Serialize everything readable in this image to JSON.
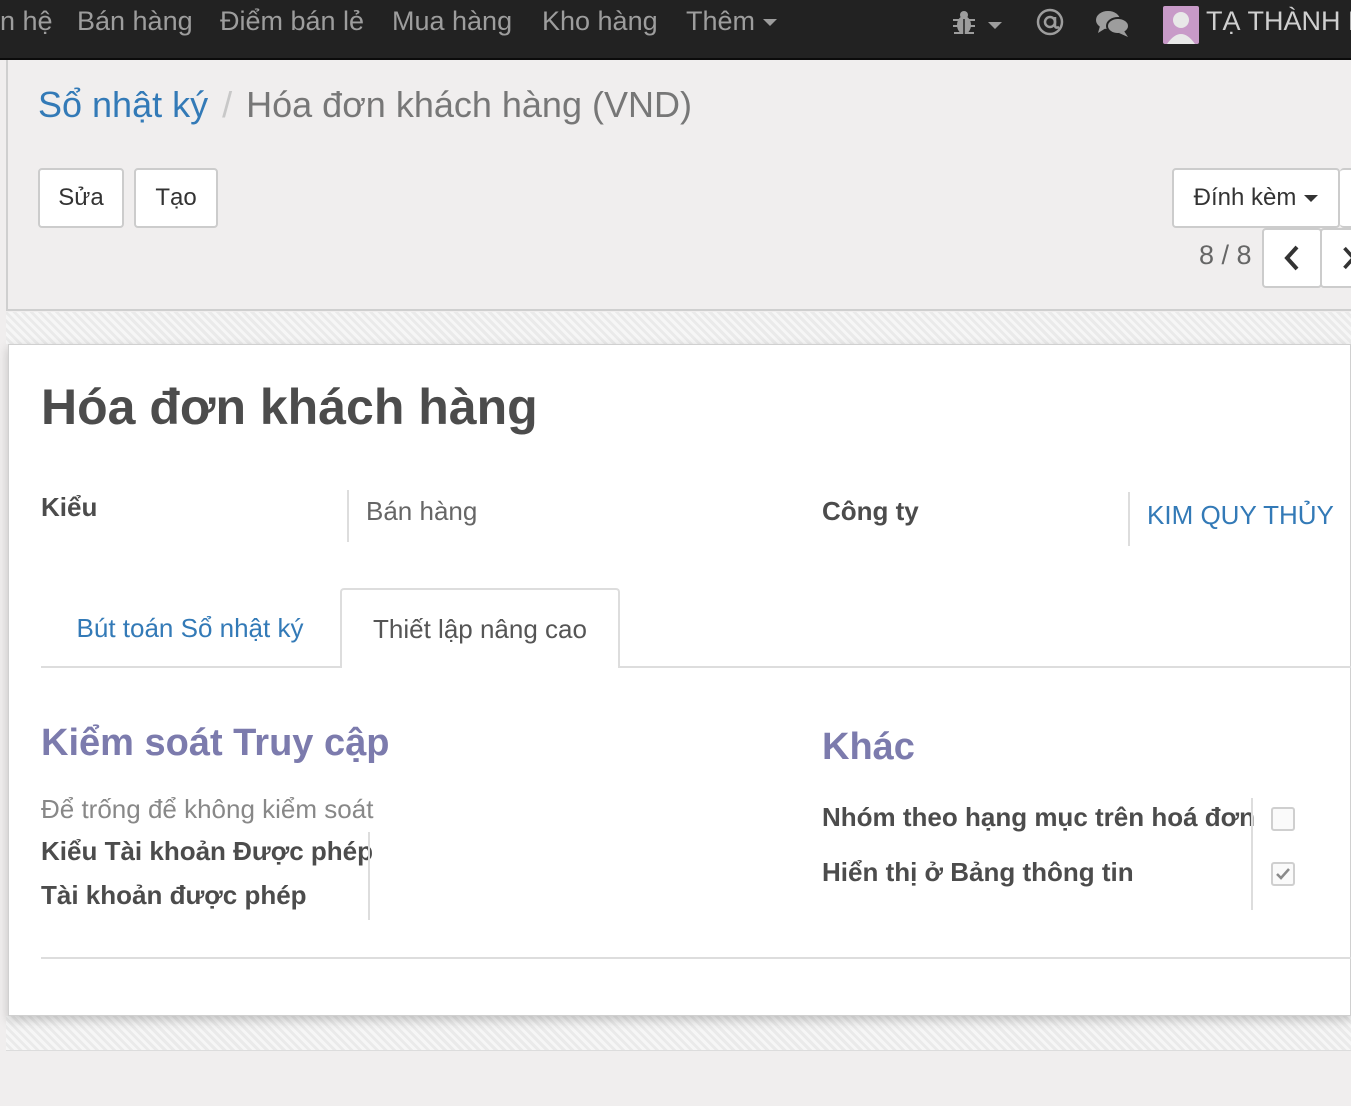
{
  "nav": {
    "menu": [
      "n hệ",
      "Bán hàng",
      "Điểm bán lẻ",
      "Mua hàng",
      "Kho hàng"
    ],
    "more_label": "Thêm",
    "user_name": "TẠ THÀNH N",
    "icons": [
      "bug-icon",
      "at-icon",
      "chat-icon"
    ]
  },
  "breadcrumb": {
    "parent": "Sổ nhật ký",
    "separator": "/",
    "current": "Hóa đơn khách hàng (VND)"
  },
  "buttons": {
    "edit": "Sửa",
    "create": "Tạo",
    "attach": "Đính kèm"
  },
  "pager": {
    "value": "8 / 8"
  },
  "record": {
    "title": "Hóa đơn khách hàng",
    "type_label": "Kiểu",
    "type_value": "Bán hàng",
    "company_label": "Công ty",
    "company_value": "KIM QUY THỦY"
  },
  "tabs": [
    {
      "label": "Bút toán Sổ nhật ký",
      "active": false
    },
    {
      "label": "Thiết lập nâng cao",
      "active": true
    }
  ],
  "access": {
    "title": "Kiểm soát Truy cập",
    "hint": "Để trống để không kiểm soát",
    "field1": "Kiểu Tài khoản Được phép",
    "field2": "Tài khoản được phép"
  },
  "other": {
    "title": "Khác",
    "group_label": "Nhóm theo hạng mục trên hoá đơn",
    "group_checked": false,
    "dashboard_label": "Hiển thị ở Bảng thông tin",
    "dashboard_checked": true
  },
  "colors": {
    "navbar": "#222222",
    "link": "#337ab7",
    "section_title": "#7c7bad"
  }
}
